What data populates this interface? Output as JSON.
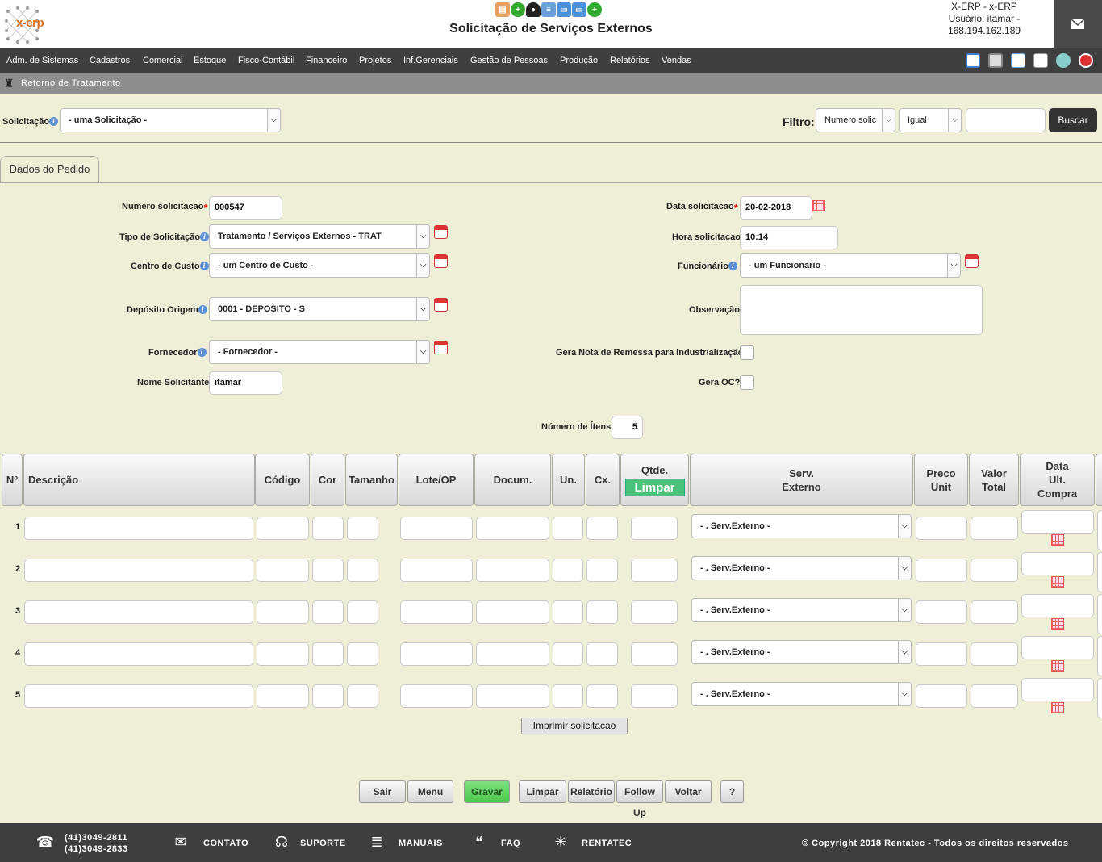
{
  "header": {
    "logo_text": "x-erp",
    "title": "Solicitação de Serviços Externos",
    "user_line1": "X-ERP - x-ERP",
    "user_line2": "Usuário: itamar -",
    "user_line3": "168.194.162.189"
  },
  "menu": [
    "Adm. de Sistemas",
    "Cadastros",
    "Comercial",
    "Estoque",
    "Fisco-Contábil",
    "Financeiro",
    "Projetos",
    "Inf.Gerenciais",
    "Gestão de Pessoas",
    "Produção",
    "Relatórios",
    "Vendas"
  ],
  "breadcrumb": "Retorno de Tratamento",
  "search": {
    "label": "Solicitação",
    "select_value": "- uma Solicitação -",
    "filter_label": "Filtro:",
    "filter_field": "Numero solic",
    "filter_op": "Igual",
    "filter_value": "",
    "button": "Buscar"
  },
  "tab": "Dados do Pedido",
  "form": {
    "numero_label": "Numero solicitacao",
    "numero_value": "000547",
    "tipo_label": "Tipo de Solicitação",
    "tipo_value": "Tratamento / Serviços Externos - TRAT",
    "centro_label": "Centro de Custo",
    "centro_value": "- um Centro de Custo -",
    "deposito_label": "Depósito Origem",
    "deposito_value": "0001 - DEPOSITO - S",
    "fornecedor_label": "Fornecedor",
    "fornecedor_value": "- Fornecedor -",
    "nome_label": "Nome Solicitante",
    "nome_value": "itamar",
    "data_label": "Data solicitacao",
    "data_value": "20-02-2018",
    "hora_label": "Hora solicitacao",
    "hora_value": "10:14",
    "funcionario_label": "Funcionário",
    "funcionario_value": "- um Funcionario -",
    "observacao_label": "Observação",
    "gera_nota_label": "Gera Nota de Remessa para Industrialização?",
    "gera_oc_label": "Gera OC?",
    "num_itens_label": "Número de Ítens",
    "num_itens_value": "5"
  },
  "grid": {
    "headers": {
      "n": "Nº",
      "descricao": "Descrição",
      "codigo": "Código",
      "cor": "Cor",
      "tamanho": "Tamanho",
      "lote": "Lote/OP",
      "docum": "Docum.",
      "un": "Un.",
      "cx": "Cx.",
      "qtde": "Qtde.",
      "limpar": "Limpar",
      "serv1": "Serv.",
      "serv2": "Externo",
      "preco1": "Preco",
      "preco2": "Unit",
      "valor1": "Valor",
      "valor2": "Total",
      "data1": "Data",
      "data2": "Ult.",
      "data3": "Compra"
    },
    "rows": [
      "1",
      "2",
      "3",
      "4",
      "5"
    ],
    "serv_placeholder": "- . Serv.Externo -"
  },
  "imprimir": "Imprimir solicitacao",
  "actions": [
    "Sair",
    "Menu",
    "Gravar",
    "Limpar",
    "Relatório",
    "Follow Up",
    "Voltar",
    "?"
  ],
  "footer": {
    "phone1": "(41)3049-2811",
    "phone2": "(41)3049-2833",
    "contato": "CONTATO",
    "suporte": "SUPORTE",
    "manuais": "MANUAIS",
    "faq": "FAQ",
    "rentatec": "RENTATEC",
    "copyright": "© Copyright 2018 Rentatec - Todos os direitos reservados"
  }
}
